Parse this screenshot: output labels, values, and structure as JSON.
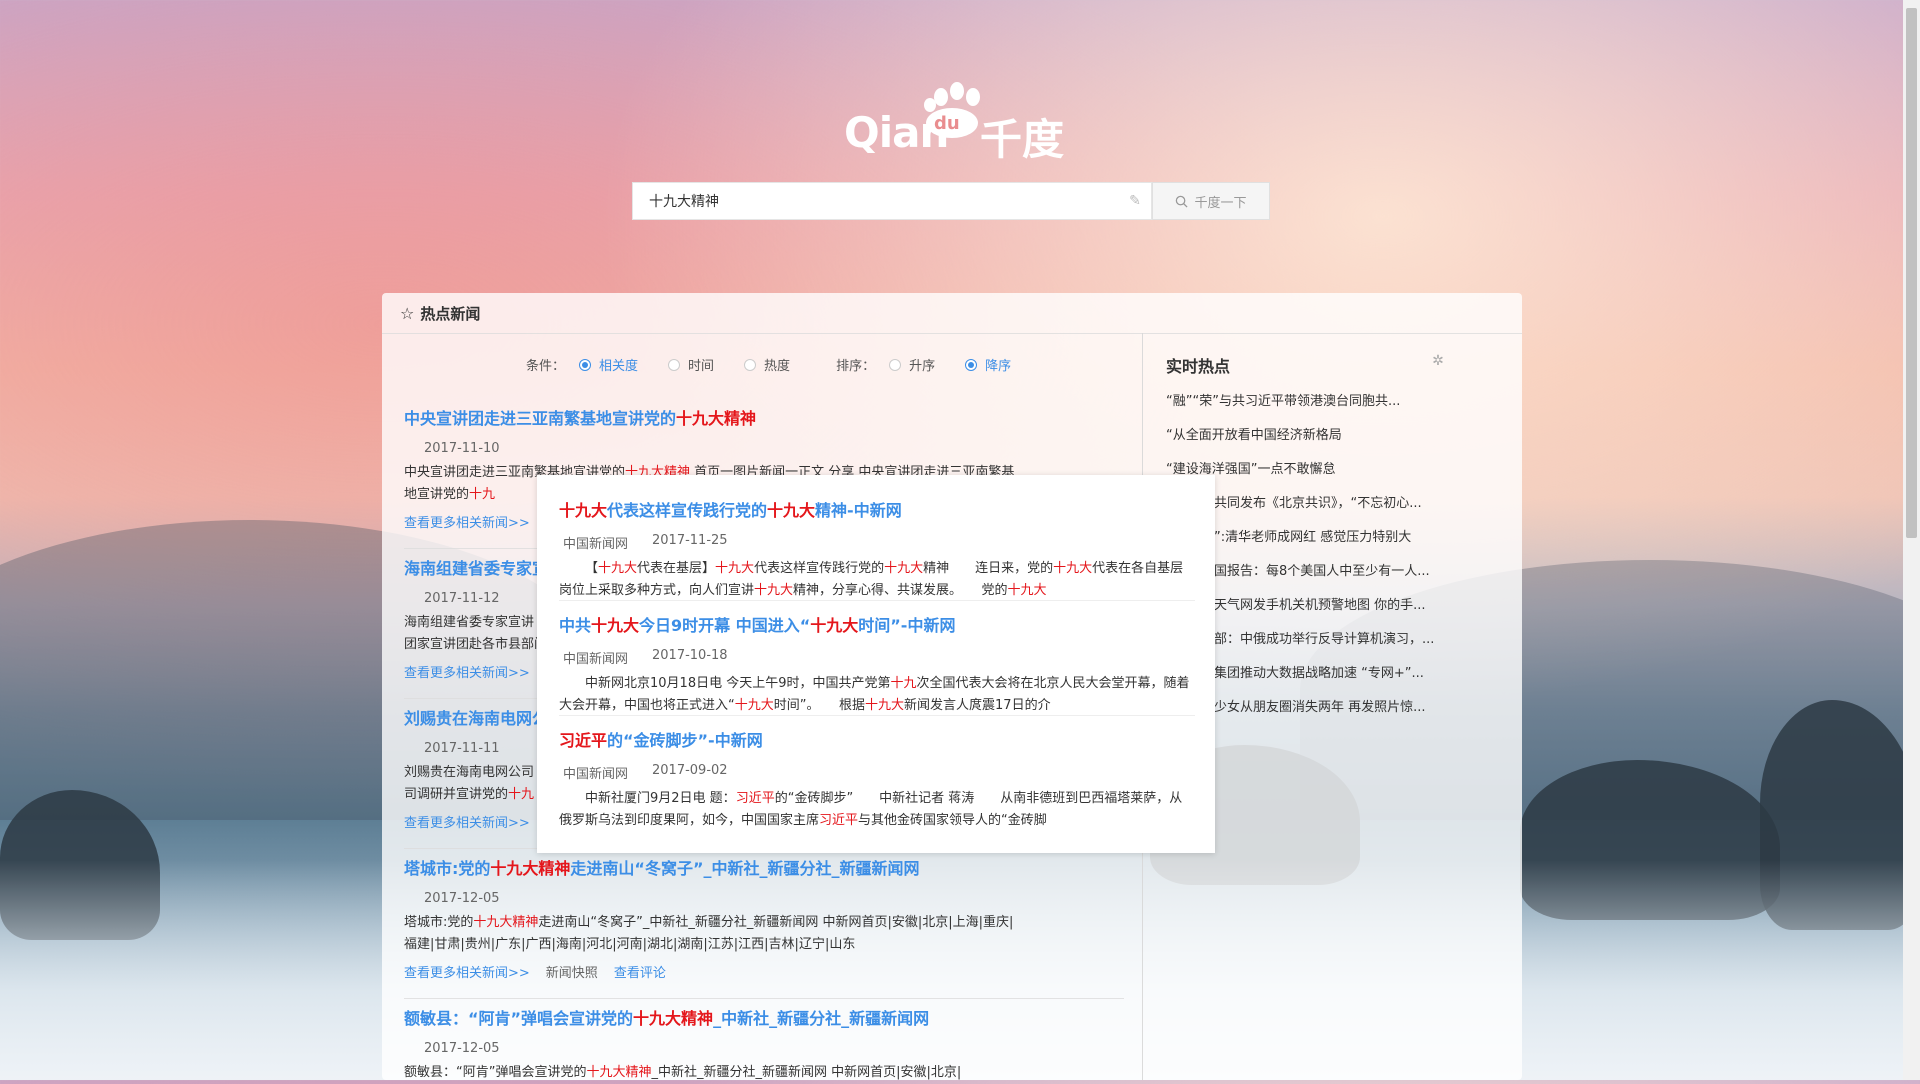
{
  "logo": {
    "part1": "Qian",
    "pad": "du",
    "part2": "千度"
  },
  "search": {
    "value": "十九大精神",
    "button_label": "千度一下"
  },
  "panel": {
    "title": "热点新闻"
  },
  "filters": {
    "condition_label": "条件：",
    "condition_options": [
      {
        "label": "相关度",
        "selected": true
      },
      {
        "label": "时间",
        "selected": false
      },
      {
        "label": "热度",
        "selected": false
      }
    ],
    "sort_label": "排序：",
    "sort_options": [
      {
        "label": "升序",
        "selected": false
      },
      {
        "label": "降序",
        "selected": true
      }
    ]
  },
  "news": [
    {
      "title_pre": "中央宣讲团走进三亚南繁基地宣讲党的",
      "title_hl": "十九大精神",
      "title_post": "",
      "date": "2017-11-10",
      "body_pre": "中央宣讲团走进三亚南繁基地宣讲党的",
      "body_hl": "十九大精神",
      "body_post": " 首页一图片新闻一正文 分享 中央宣讲团走进三亚南繁基地宣讲党的",
      "body_hl2": "十九",
      "more": "查看更多相关新闻>>"
    },
    {
      "title_pre": "海南组建省委专家宣",
      "title_hl": "",
      "title_post": "",
      "date": "2017-11-12",
      "body_pre": "海南组建省委专家宣讲",
      "body_hl": "",
      "body_post": "团家宣讲团赴各市县部门",
      "more": "查看更多相关新闻>>"
    },
    {
      "title_pre": "刘赐贵在海南电网公",
      "title_hl": "",
      "title_post": "",
      "date": "2017-11-11",
      "body_pre": "刘赐贵在海南电网公司",
      "body_hl": "",
      "body_post": "司调研并宣讲党的",
      "body_hl2": "十九",
      "more": "查看更多相关新闻>>"
    },
    {
      "title_pre": "塔城市:党的",
      "title_hl": "十九大精神",
      "title_post": "走进南山“冬窝子”_中新社_新疆分社_新疆新闻网",
      "date": "2017-12-05",
      "body_pre": "塔城市:党的",
      "body_hl": "十九大精神",
      "body_post": "走进南山“冬窝子”_中新社_新疆分社_新疆新闻网 中新网首页|安徽|北京|上海|重庆|福建|甘肃|贵州|广东|广西|海南|河北|河南|湖北|湖南|江苏|江西|吉林|辽宁|山东",
      "more": "查看更多相关新闻>>",
      "snapshot": "新闻快照",
      "comment": "查看评论"
    },
    {
      "title_pre": "额敏县：“阿肯”弹唱会宣讲党的",
      "title_hl": "十九大精神",
      "title_post": "_中新社_新疆分社_新疆新闻网",
      "date": "2017-12-05",
      "body_pre": "额敏县：“阿肯”弹唱会宣讲党的",
      "body_hl": "十九大精神",
      "body_post": "_中新社_新疆分社_新疆新闻网 中新网首页|安徽|北京|"
    }
  ],
  "hot": {
    "title": "实时热点",
    "items": [
      "“融”“荣”与共习近平带领港澳台同胞共...",
      "“从全面开放看中国经济新格局",
      "“建设海洋强国”一点不敢懈怠",
      "共同发布《北京共识》，“不忘初心...",
      "”:清华老师成网红 感觉压力特别大",
      "国报告：每8个美国人中至少有一人...",
      "天气网发手机关机预警地图 你的手...",
      "部：中俄成功举行反导计算机演习，...",
      "集团推动大数据战略加速 “专网+”...",
      "少女从朋友圈消失两年 再发照片惊..."
    ]
  },
  "popup": [
    {
      "title_hl": "十九大",
      "title_mid": "代表这样宣传践行党的",
      "title_hl2": "十九大",
      "title_post": "精神-中新网",
      "source": "中国新闻网",
      "date": "2017-11-25",
      "body": [
        {
          "t": "【"
        },
        {
          "h": "十九大"
        },
        {
          "t": "代表在基层】"
        },
        {
          "h": "十九大"
        },
        {
          "t": "代表这样宣传践行党的"
        },
        {
          "h": "十九大"
        },
        {
          "t": "精神　　连日来，党的"
        },
        {
          "h": "十九大"
        },
        {
          "t": "代表在各自基层岗位上采取多种方式，向人们宣讲"
        },
        {
          "h": "十九大"
        },
        {
          "t": "精神，分享心得、共谋发展。　　党的"
        },
        {
          "h": "十九大"
        }
      ]
    },
    {
      "title_pre": "中共",
      "title_hl": "十九大",
      "title_mid": "今日9时开幕 中国进入“",
      "title_hl2": "十九大",
      "title_post": "时间”-中新网",
      "source": "中国新闻网",
      "date": "2017-10-18",
      "body": [
        {
          "t": "中新网北京10月18日电 今天上午9时，中国共产党第"
        },
        {
          "h": "十九"
        },
        {
          "t": "次全国代表大会将在北京人民大会堂开幕，随着大会开幕，中国也将正式进入“"
        },
        {
          "h": "十九大"
        },
        {
          "t": "时间”。　　根据"
        },
        {
          "h": "十九大"
        },
        {
          "t": "新闻发言人庹震17日的介"
        }
      ]
    },
    {
      "title_hl": "习近平",
      "title_post": "的“金砖脚步”-中新网",
      "source": "中国新闻网",
      "date": "2017-09-02",
      "body": [
        {
          "t": "中新社厦门9月2日电 题："
        },
        {
          "h": "习近平"
        },
        {
          "t": "的“金砖脚步”　　中新社记者 蒋涛　　从南非德班到巴西福塔莱萨，从俄罗斯乌法到印度果阿，如今，中国国家主席"
        },
        {
          "h": "习近平"
        },
        {
          "t": "与其他金砖国家领导人的“金砖脚"
        }
      ]
    }
  ]
}
